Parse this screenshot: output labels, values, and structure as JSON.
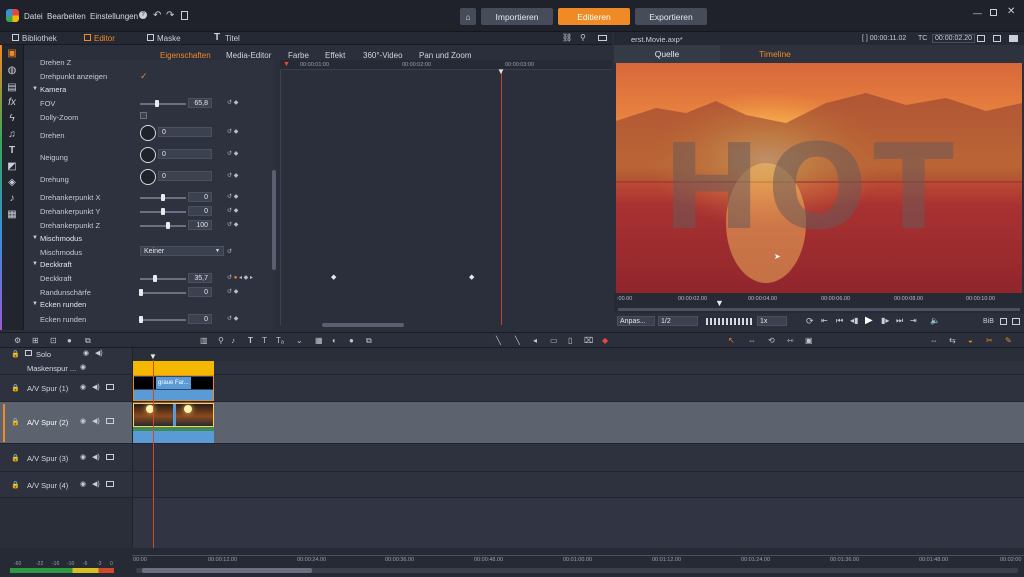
{
  "menu": {
    "items": [
      "Datei",
      "Bearbeiten",
      "Einstellungen"
    ]
  },
  "nav": {
    "import": "Importieren",
    "edit": "Editieren",
    "export": "Exportieren"
  },
  "tabs": {
    "library": "Bibliothek",
    "editor": "Editor",
    "mask": "Maske",
    "title": "Titel"
  },
  "proptabs": [
    "Eigenschaften",
    "Media-Editor",
    "Farbe",
    "Effekt",
    "360°-Video",
    "Pan und Zoom"
  ],
  "props": {
    "rotate_z": "Drehen Z",
    "show_pivot": "Drehpunkt anzeigen",
    "camera": "Kamera",
    "fov": "FOV",
    "fov_val": "65,8",
    "dolly": "Dolly-Zoom",
    "rotate": "Drehen",
    "rotate_val": "0",
    "tilt": "Neigung",
    "tilt_val": "0",
    "turn": "Drehung",
    "turn_val": "0",
    "pivot_x": "Drehankerpunkt X",
    "pivot_x_val": "0",
    "pivot_y": "Drehankerpunkt Y",
    "pivot_y_val": "0",
    "pivot_z": "Drehankerpunkt Z",
    "pivot_z_val": "100",
    "blend_section": "Mischmodus",
    "blend": "Mischmodus",
    "blend_val": "Keiner",
    "opacity_section": "Deckkraft",
    "opacity": "Deckkraft",
    "opacity_val": "35,7",
    "edge": "Randunschärfe",
    "edge_val": "0",
    "round_section": "Ecken runden",
    "round": "Ecken runden",
    "round_val": "0"
  },
  "keyframe_ruler": [
    "00:00:01:00",
    "00:00:02:00",
    "00:00:03:00"
  ],
  "preview": {
    "filename": "erst.Movie.axp*",
    "time1": "[ ] 00:00:11.02",
    "tc_label": "TC",
    "time2": "00:00:02.20",
    "tab_source": "Quelle",
    "tab_timeline": "Timeline",
    "overlay_text": "HOT"
  },
  "preview_ruler": [
    ":00.00",
    "00:00:02.00",
    "00:00:04.00",
    "00:00:06.00",
    "00:00:08.00",
    "00:00:10.00"
  ],
  "preview_ctl": {
    "fit": "Anpas...",
    "ratio": "1/2",
    "speed": "1x",
    "quality": "BiB"
  },
  "tracks": {
    "solo": "Solo",
    "mask": "Maskenspur ...",
    "t1": "A/V Spur (1)",
    "t2": "A/V Spur (2)",
    "t3": "A/V Spur (3)",
    "t4": "A/V Spur (4)",
    "clip_label": "graue Far..."
  },
  "tl_ruler": [
    "00:00",
    "00:00:12.00",
    "00:00:24.00",
    "00:00:36.00",
    "00:00:48.00",
    "00:01:00.00",
    "00:01:12.00",
    "00:01:24.00",
    "00:01:36.00",
    "00:01:48.00",
    "00:02:00"
  ],
  "meter": [
    "-60",
    "-22",
    "-16",
    "-10",
    "-6",
    "-3",
    "0"
  ],
  "colors": {
    "accent": "#f08a24",
    "track_clip": "#f5b800",
    "clip_blue": "#5a9bd6"
  }
}
